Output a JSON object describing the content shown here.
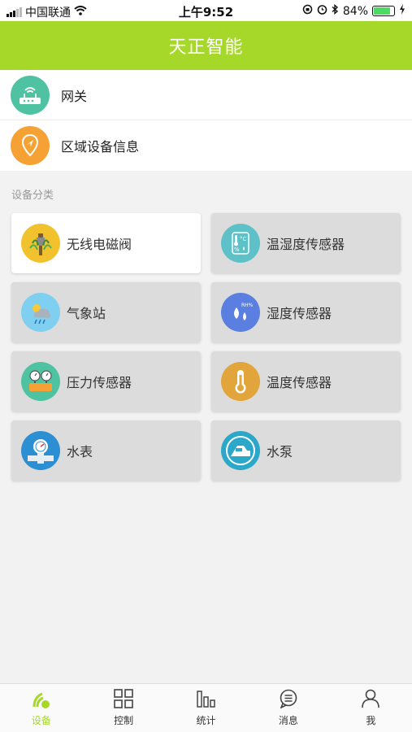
{
  "status_bar": {
    "carrier": "中国联通",
    "time": "上午9:52",
    "battery_percent": "84%",
    "battery_level": 0.84,
    "icons": [
      "signal-icon",
      "wifi-icon",
      "rotation-lock-icon",
      "alarm-icon",
      "bluetooth-icon",
      "battery-icon",
      "charging-icon"
    ]
  },
  "header": {
    "title": "天正智能"
  },
  "list": [
    {
      "label": "网关",
      "icon": "router-icon",
      "color": "#4fc3a1"
    },
    {
      "label": "区域设备信息",
      "icon": "map-pin-icon",
      "color": "#f5a133"
    }
  ],
  "section_label": "设备分类",
  "categories": [
    {
      "label": "无线电磁阀",
      "icon": "solenoid-valve-icon",
      "color": "#f2c22e",
      "selected": true
    },
    {
      "label": "温湿度传感器",
      "icon": "temp-humidity-icon",
      "color": "#5fc1c8",
      "selected": false
    },
    {
      "label": "气象站",
      "icon": "weather-icon",
      "color": "#7fd0f0",
      "selected": false
    },
    {
      "label": "湿度传感器",
      "icon": "humidity-icon",
      "color": "#5b7fe0",
      "selected": false
    },
    {
      "label": "压力传感器",
      "icon": "pressure-gauge-icon",
      "color": "#4fc3a1",
      "selected": false
    },
    {
      "label": "温度传感器",
      "icon": "thermometer-icon",
      "color": "#e2a53b",
      "selected": false
    },
    {
      "label": "水表",
      "icon": "water-meter-icon",
      "color": "#2d8fd3",
      "selected": false
    },
    {
      "label": "水泵",
      "icon": "water-pump-icon",
      "color": "#2aa7c9",
      "selected": false
    }
  ],
  "tabs": [
    {
      "label": "设备",
      "icon": "device-icon",
      "active": true
    },
    {
      "label": "控制",
      "icon": "grid-icon",
      "active": false
    },
    {
      "label": "统计",
      "icon": "bar-chart-icon",
      "active": false
    },
    {
      "label": "消息",
      "icon": "message-icon",
      "active": false
    },
    {
      "label": "我",
      "icon": "user-icon",
      "active": false
    }
  ],
  "colors": {
    "accent": "#a6d82a",
    "card": "#dcdcdc",
    "card_selected": "#ffffff"
  }
}
